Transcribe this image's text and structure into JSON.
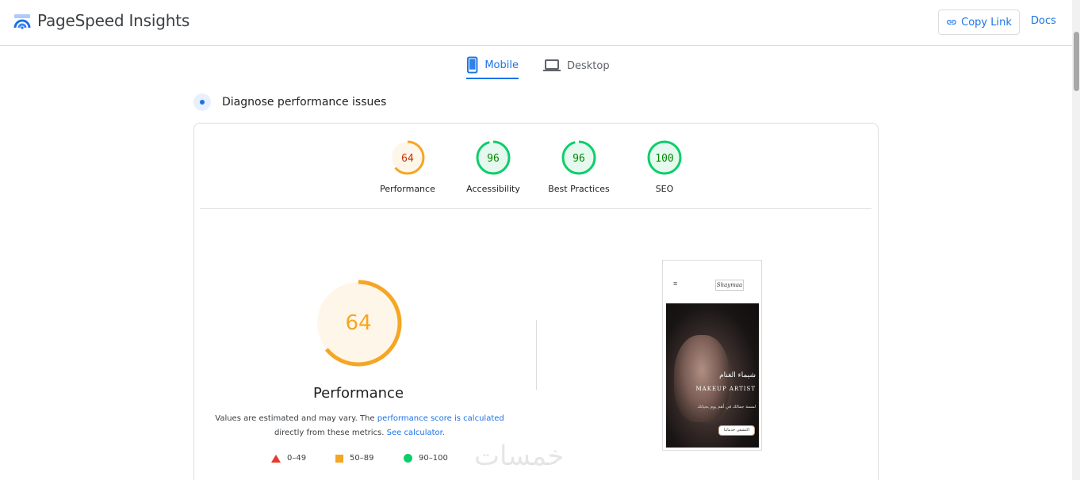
{
  "header": {
    "app_title": "PageSpeed Insights",
    "copy_link_label": "Copy Link",
    "docs_label": "Docs"
  },
  "tabs": [
    {
      "label": "Mobile",
      "active": true
    },
    {
      "label": "Desktop",
      "active": false
    }
  ],
  "diagnose": {
    "title": "Diagnose performance issues"
  },
  "scores": [
    {
      "label": "Performance",
      "value": 64,
      "status": "average"
    },
    {
      "label": "Accessibility",
      "value": 96,
      "status": "pass"
    },
    {
      "label": "Best Practices",
      "value": 96,
      "status": "pass"
    },
    {
      "label": "SEO",
      "value": 100,
      "status": "pass"
    }
  ],
  "main": {
    "score": 64,
    "title": "Performance",
    "note_prefix": "Values are estimated and may vary. The ",
    "note_link1": "performance score is calculated",
    "note_middle": "directly from these metrics. ",
    "note_link2": "See calculator."
  },
  "legend": [
    {
      "range": "0–49",
      "kind": "fail"
    },
    {
      "range": "50–89",
      "kind": "average"
    },
    {
      "range": "90–100",
      "kind": "pass"
    }
  ],
  "screenshot": {
    "logo_text": "Shaymaa",
    "menu_icon": "≡",
    "hero_title_ar": "شيماء الغنام",
    "hero_title_en": "MAKEUP ARTIST",
    "hero_subtitle": "لمسة جمالك في أهم يوم بحياتك",
    "hero_button": "اكتشفي خدماتنا"
  },
  "watermark": "خمسات",
  "colors": {
    "accent": "#1a73e8",
    "fail": "#e8392d",
    "average": "#f5a623",
    "average_text": "#c33300",
    "pass": "#0cce6b",
    "pass_text": "#008800",
    "average_bg": "#fff6ea",
    "pass_bg": "#e6f9ee"
  }
}
